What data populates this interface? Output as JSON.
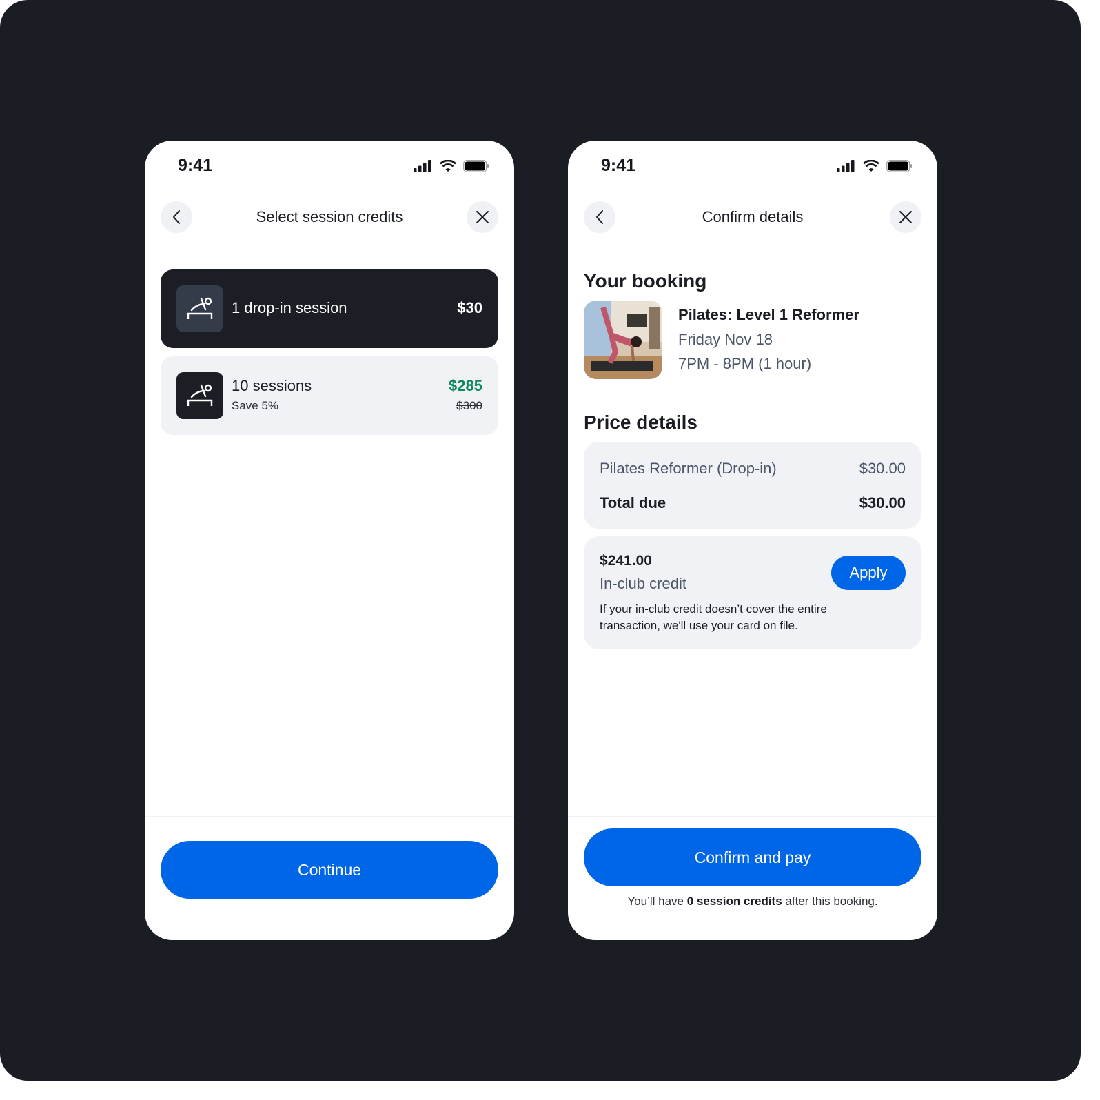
{
  "status_bar": {
    "time": "9:41"
  },
  "screen_select": {
    "title": "Select session credits",
    "options": [
      {
        "label": "1 drop-in session",
        "price": "$30",
        "selected": true
      },
      {
        "label": "10 sessions",
        "subtitle": "Save 5%",
        "price": "$285",
        "original_price": "$300",
        "selected": false
      }
    ],
    "continue_label": "Continue"
  },
  "screen_confirm": {
    "title": "Confirm details",
    "booking_heading": "Your booking",
    "booking": {
      "class_name": "Pilates: Level 1 Reformer",
      "date": "Friday Nov 18",
      "time": "7PM - 8PM (1 hour)"
    },
    "price_heading": "Price details",
    "price_items": [
      {
        "label": "Pilates Reformer (Drop-in)",
        "amount": "$30.00"
      }
    ],
    "total_label": "Total due",
    "total_amount": "$30.00",
    "credit": {
      "amount": "$241.00",
      "label": "In-club credit",
      "description": "If your in-club credit doesn’t cover the entire transaction, we'll use your card on file.",
      "apply_label": "Apply"
    },
    "confirm_label": "Confirm and pay",
    "note_prefix": "You’ll have ",
    "note_bold": "0 session credits",
    "note_suffix": " after this booking."
  },
  "colors": {
    "primary": "#0066e8",
    "savings": "#0f8a5f",
    "dark_card": "#1b1e24",
    "background": "#1a1d24"
  }
}
